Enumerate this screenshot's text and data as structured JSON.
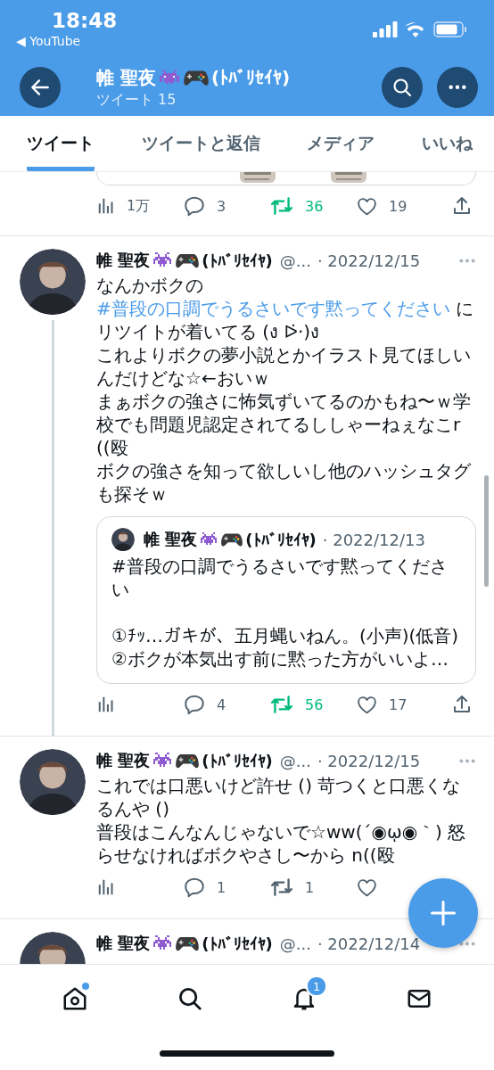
{
  "status_bar": {
    "time": "18:48",
    "back_app": "◀ YouTube"
  },
  "header": {
    "name": "帷 聖夜",
    "name_suffix": "(ﾄﾊﾞﾘｾｲﾔ)",
    "subtitle": "ツイート 15"
  },
  "tabs": [
    {
      "label": "ツイート",
      "selected": true
    },
    {
      "label": "ツイートと返信",
      "selected": false
    },
    {
      "label": "メディア",
      "selected": false
    },
    {
      "label": "いいね",
      "selected": false
    }
  ],
  "tweets": [
    {
      "kind": "partial",
      "actions": [
        {
          "kind": "views",
          "count": "1万"
        },
        {
          "kind": "reply",
          "count": "3"
        },
        {
          "kind": "retweet",
          "count": "36",
          "retweeted": true
        },
        {
          "kind": "like",
          "count": "19"
        },
        {
          "kind": "share"
        }
      ]
    },
    {
      "kind": "full",
      "thread": true,
      "name": "帷 聖夜",
      "name_suffix": "(ﾄﾊﾞﾘｾｲﾔ)",
      "handle": "@...",
      "date": "· 2022/12/15",
      "paragraphs": [
        [
          {
            "kind": "plain",
            "text": "なんかボクの "
          },
          {
            "kind": "hashtag",
            "text": "#普段の口調でうるさいです黙ってください"
          },
          {
            "kind": "plain",
            "text": " にリツイトが着いてる (ง ᐅ̇·)ง"
          }
        ],
        [
          {
            "kind": "plain",
            "text": "これよりボクの夢小説とかイラスト見てほしいんだけどな☆←おいｗ"
          }
        ],
        [
          {
            "kind": "plain",
            "text": "まぁボクの強さに怖気ずいてるのかもね〜ｗ学校でも問題児認定されてるししゃーねぇなこr((殴"
          }
        ],
        [
          {
            "kind": "plain",
            "text": "ボクの強さを知って欲しいし他のハッシュタグも探そｗ"
          }
        ]
      ],
      "quote": {
        "name": "帷 聖夜",
        "name_suffix": "(ﾄﾊﾞﾘｾｲﾔ)",
        "date": "· 2022/12/13",
        "blocks": [
          [
            "#普段の口調でうるさいです黙ってください"
          ],
          [
            "①ﾁｯ…ガキが、五月蝿いねん。(小声)(低音)",
            "②ボクが本気出す前に黙った方がいいよ…"
          ]
        ]
      },
      "actions": [
        {
          "kind": "views"
        },
        {
          "kind": "reply",
          "count": "4"
        },
        {
          "kind": "retweet",
          "count": "56",
          "retweeted": true
        },
        {
          "kind": "like",
          "count": "17"
        },
        {
          "kind": "share"
        }
      ]
    },
    {
      "kind": "full",
      "thread": false,
      "name": "帷 聖夜",
      "name_suffix": "(ﾄﾊﾞﾘｾｲﾔ)",
      "handle": "@...",
      "date": "· 2022/12/15",
      "paragraphs": [
        [
          {
            "kind": "plain",
            "text": "これでは口悪いけど許せ () 苛つくと口悪くなるんや ()"
          }
        ],
        [
          {
            "kind": "plain",
            "text": "普段はこんなんじゃないで☆ww(´◉ῳ◉｀) 怒らせなければボクやさし〜から n((殴"
          }
        ]
      ],
      "actions": [
        {
          "kind": "views"
        },
        {
          "kind": "reply",
          "count": "1"
        },
        {
          "kind": "retweet",
          "count": "1",
          "retweeted": false
        },
        {
          "kind": "like"
        }
      ]
    },
    {
      "kind": "header_only",
      "name": "帷 聖夜",
      "name_suffix": "(ﾄﾊﾞﾘｾｲﾔ)",
      "handle": "@...",
      "date": "· 2022/12/14"
    }
  ],
  "bottom_nav": [
    {
      "kind": "home",
      "dot": true
    },
    {
      "kind": "search"
    },
    {
      "kind": "notifications",
      "badge": "1"
    },
    {
      "kind": "messages"
    }
  ]
}
